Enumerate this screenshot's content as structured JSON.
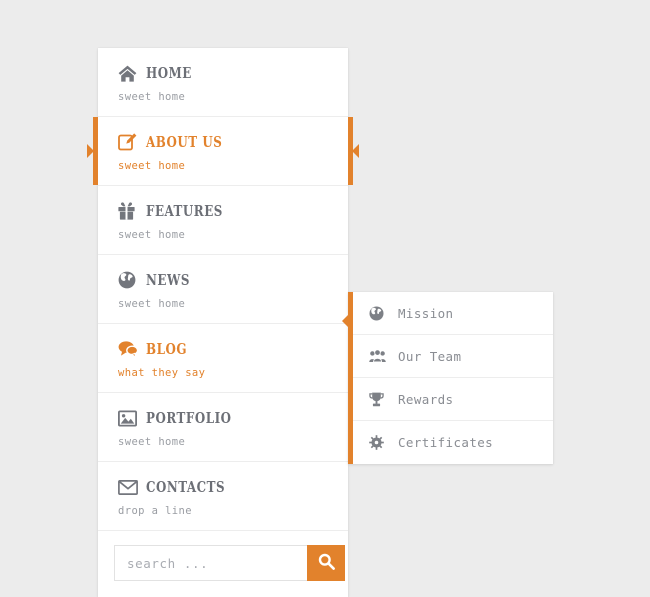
{
  "theme": {
    "accent": "#e2822c",
    "page_background": "#ececec",
    "panel_background": "#ffffff",
    "title_color": "#6c6f76",
    "subtitle_color": "#9a9da3",
    "divider_color": "#ededed"
  },
  "menu": {
    "items": [
      {
        "icon": "home-icon",
        "title": "HOME",
        "subtitle": "sweet home",
        "active": false
      },
      {
        "icon": "edit-icon",
        "title": "ABOUT US",
        "subtitle": "sweet home",
        "active": true
      },
      {
        "icon": "gift-icon",
        "title": "FEATURES",
        "subtitle": "sweet home",
        "active": false
      },
      {
        "icon": "globe-icon",
        "title": "NEWS",
        "subtitle": "sweet home",
        "active": false
      },
      {
        "icon": "comments-icon",
        "title": "BLOG",
        "subtitle": "what they say",
        "active": false
      },
      {
        "icon": "image-icon",
        "title": "PORTFOLIO",
        "subtitle": "sweet home",
        "active": false
      },
      {
        "icon": "envelope-icon",
        "title": "CONTACTS",
        "subtitle": "drop a line",
        "active": false
      }
    ]
  },
  "search": {
    "placeholder": "search ...",
    "value": "",
    "button_icon": "search-icon"
  },
  "submenu": {
    "items": [
      {
        "icon": "globe-icon",
        "label": "Mission"
      },
      {
        "icon": "users-icon",
        "label": "Our Team"
      },
      {
        "icon": "trophy-icon",
        "label": "Rewards"
      },
      {
        "icon": "gear-icon",
        "label": "Certificates"
      }
    ]
  }
}
